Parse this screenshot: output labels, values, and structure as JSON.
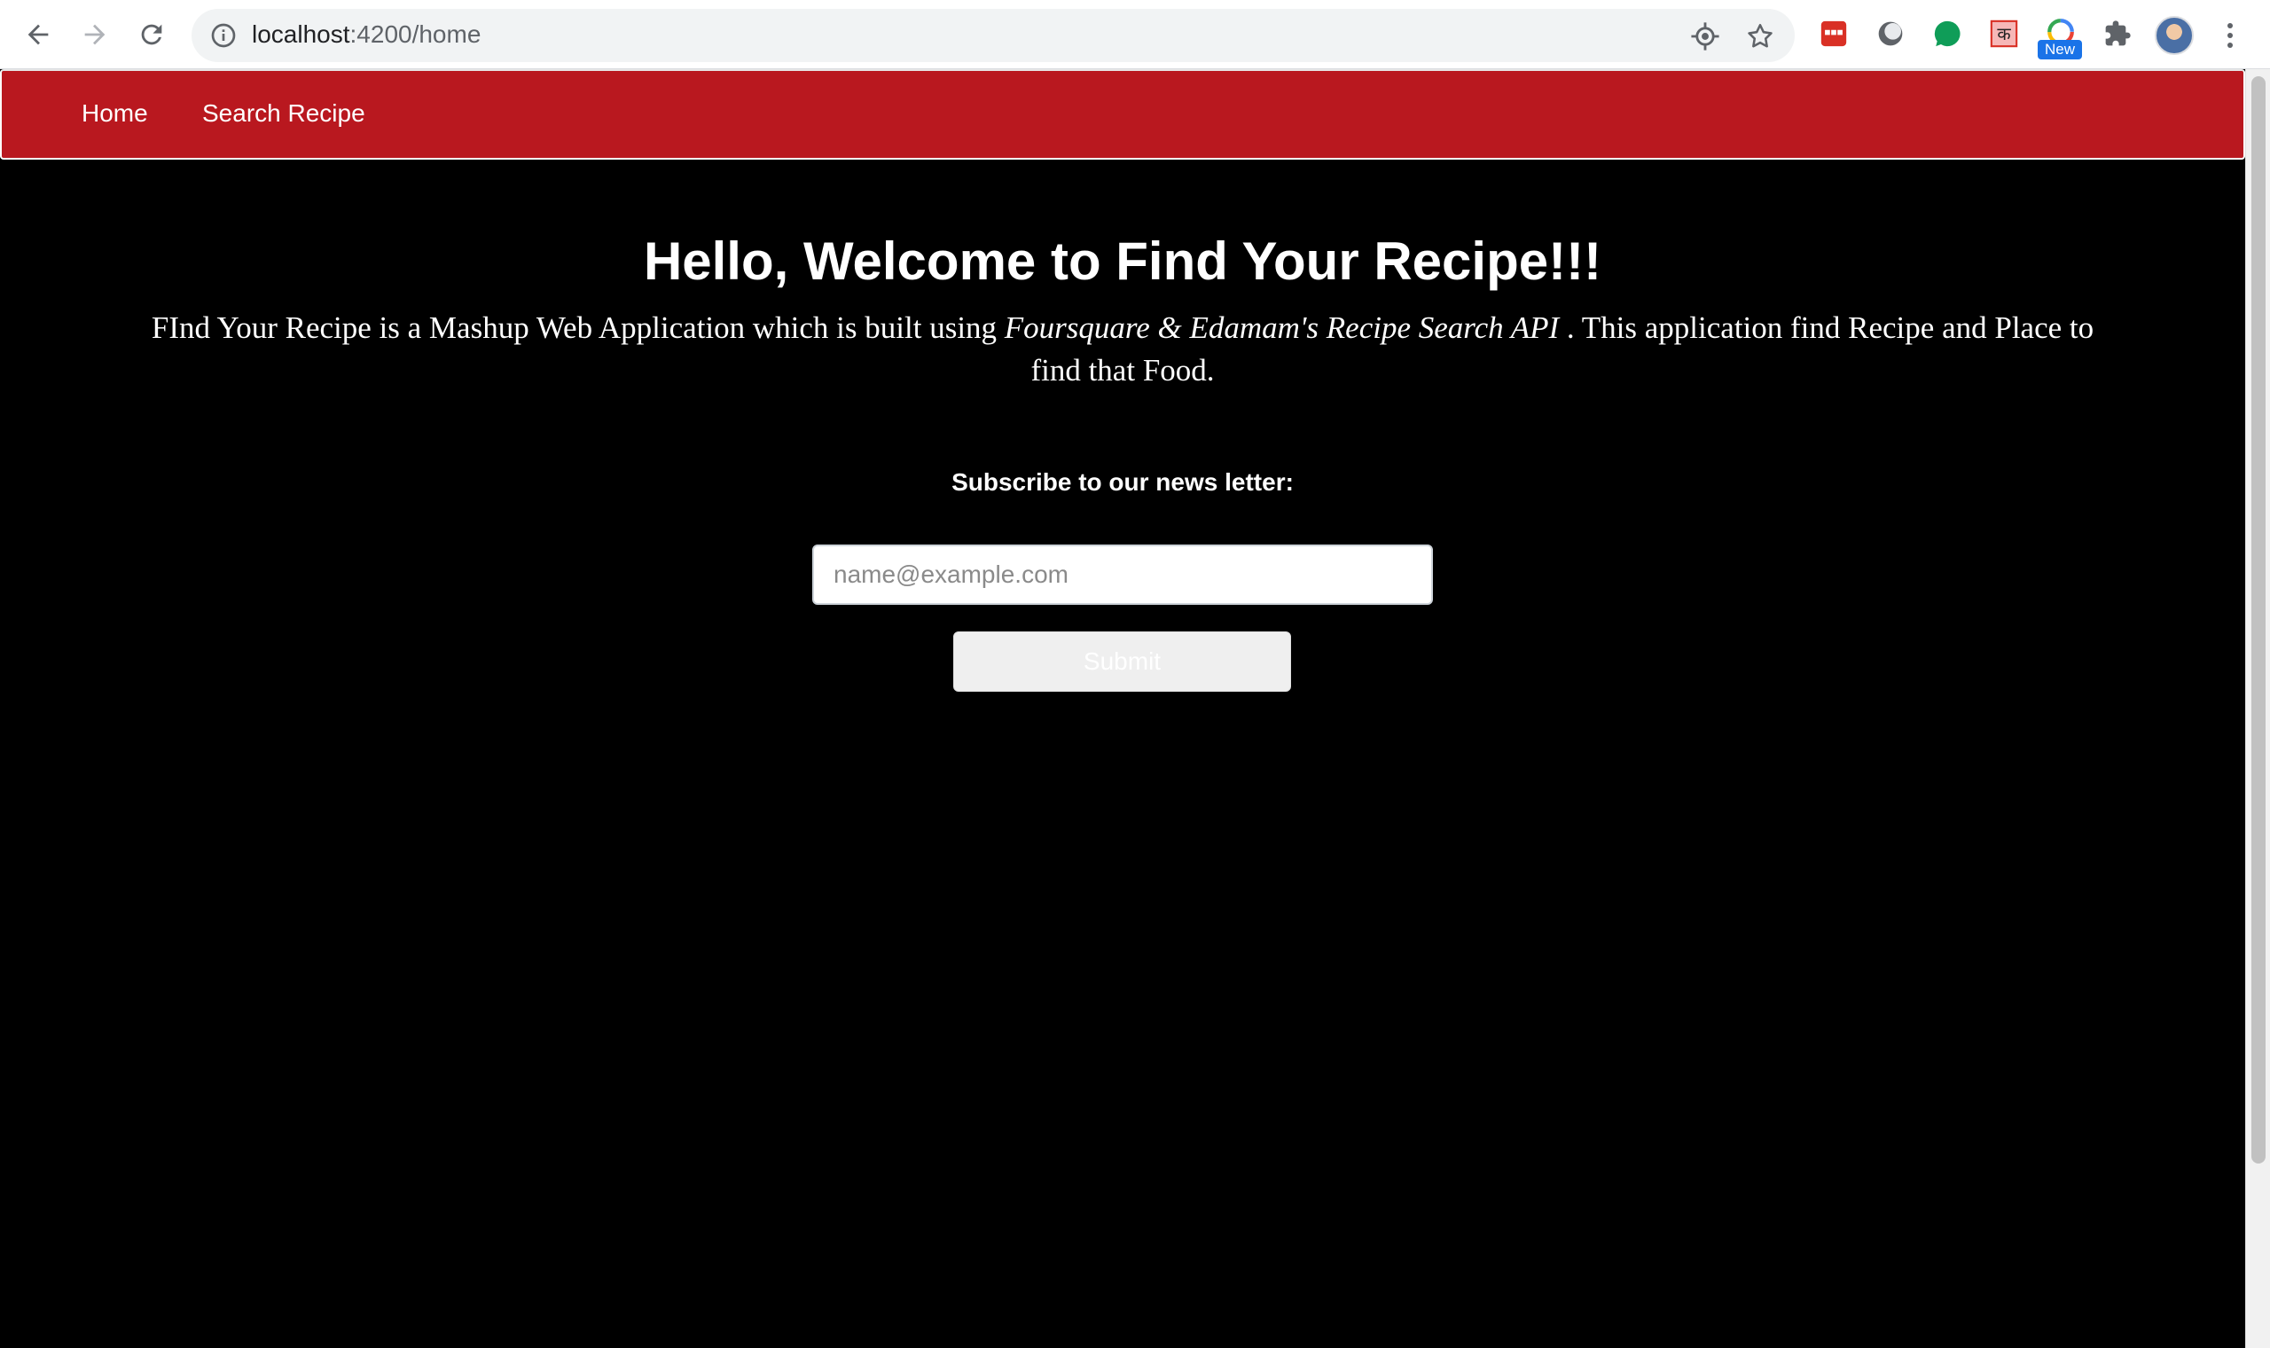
{
  "browser": {
    "url_host": "localhost",
    "url_path": ":4200/home",
    "new_badge": "New",
    "extensions": [
      {
        "icon": "red-ext-icon"
      },
      {
        "icon": "moon-ext-icon"
      },
      {
        "icon": "green-bubble-ext-icon"
      },
      {
        "icon": "hindi-ka-ext-icon",
        "glyph": "क"
      },
      {
        "icon": "color-ring-ext-icon"
      },
      {
        "icon": "puzzle-extensions-icon"
      }
    ]
  },
  "navbar": {
    "color": "#b9181f",
    "links": [
      "Home",
      "Search Recipe"
    ]
  },
  "hero": {
    "title": "Hello, Welcome to Find Your Recipe!!!",
    "desc_before": "FInd Your Recipe is a Mashup Web Application which is built using ",
    "desc_italic": "Foursquare & Edamam's Recipe Search API",
    "desc_after": " . This application find Recipe and Place to find that Food."
  },
  "subscribe": {
    "label": "Subscribe to our news letter:",
    "placeholder": "name@example.com",
    "value": "",
    "button": "Submit"
  }
}
